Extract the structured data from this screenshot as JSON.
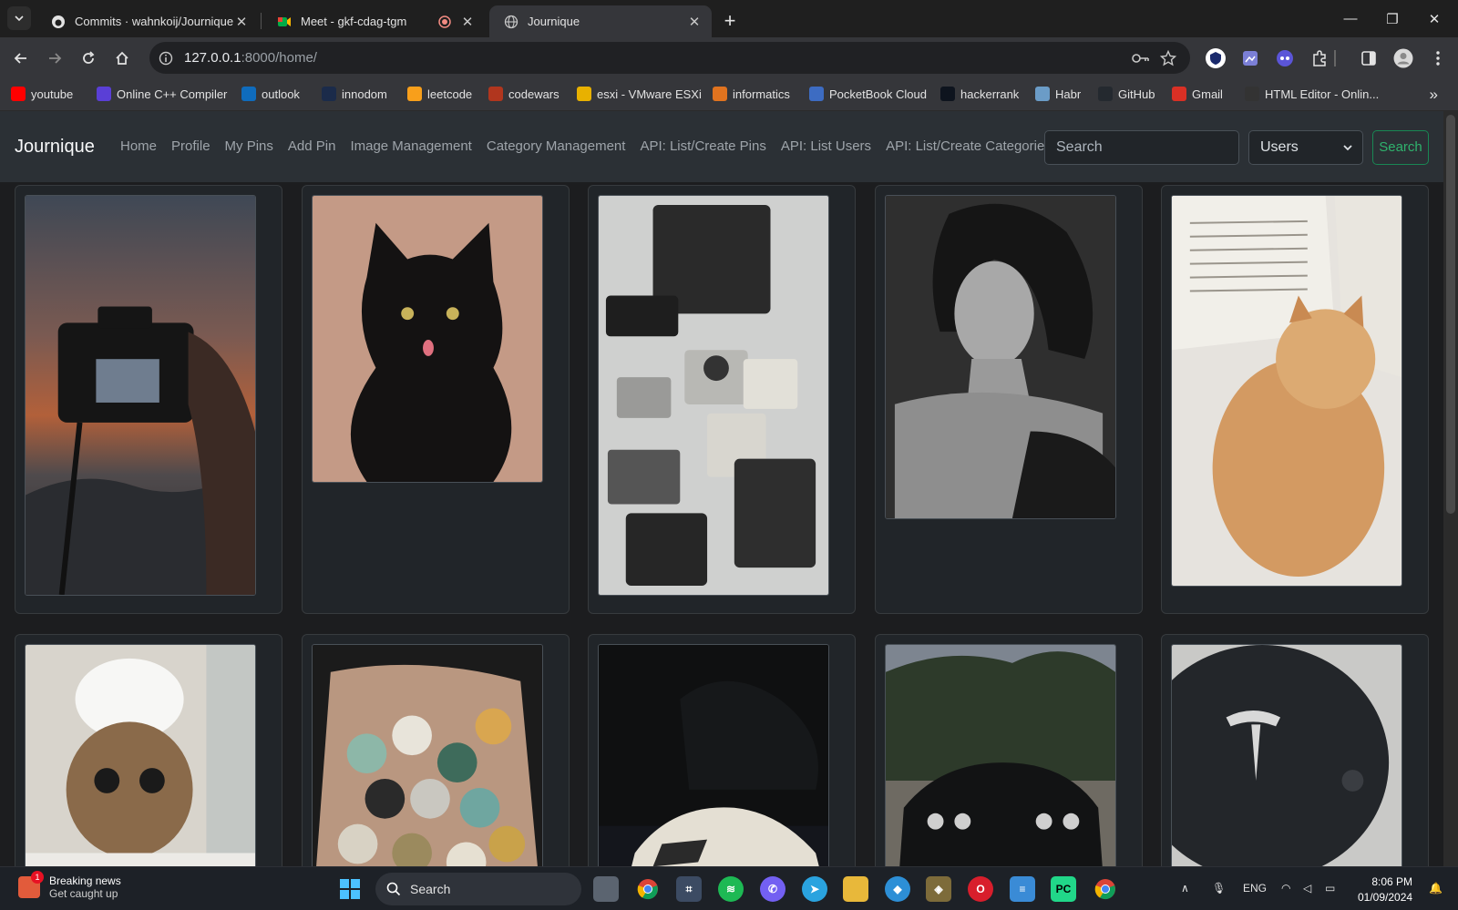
{
  "browser": {
    "tabs": [
      {
        "title": "Commits · wahnkoij/Journique",
        "icon": "github-icon"
      },
      {
        "title": "Meet - gkf-cdag-tgm",
        "icon": "google-meet-icon"
      },
      {
        "title": "Journique",
        "icon": "globe-icon",
        "active": true
      }
    ],
    "url_host": "127.0.0.1",
    "url_rest": ":8000/home/",
    "bookmarks": [
      {
        "label": "youtube",
        "color": "#ff0000"
      },
      {
        "label": "Online C++ Compiler",
        "color": "#5a3fd6"
      },
      {
        "label": "outlook",
        "color": "#0f6cbd"
      },
      {
        "label": "innodom",
        "color": "#1b2b4a"
      },
      {
        "label": "leetcode",
        "color": "#f89f1b"
      },
      {
        "label": "codewars",
        "color": "#b1361e"
      },
      {
        "label": "esxi - VMware ESXi",
        "color": "#e8b100"
      },
      {
        "label": "informatics",
        "color": "#e0731f"
      },
      {
        "label": "PocketBook Cloud",
        "color": "#3d6cc2"
      },
      {
        "label": "hackerrank",
        "color": "#0e141e"
      },
      {
        "label": "Habr",
        "color": "#6b9cc7"
      },
      {
        "label": "GitHub",
        "color": "#24292f"
      },
      {
        "label": "Gmail",
        "color": "#d93025"
      },
      {
        "label": "HTML Editor - Onlin...",
        "color": "#333333"
      }
    ]
  },
  "app": {
    "brand": "Journique",
    "nav": [
      "Home",
      "Profile",
      "My Pins",
      "Add Pin",
      "Image Management",
      "Category Management",
      "API: List/Create Pins",
      "API: List Users",
      "API: List/Create Categories"
    ],
    "search_placeholder": "Search",
    "filter_selected": "Users",
    "search_button": "Search",
    "pins": [
      {
        "subject": "camera-sunset"
      },
      {
        "subject": "black-cat"
      },
      {
        "subject": "vintage-cameras"
      },
      {
        "subject": "bw-portrait"
      },
      {
        "subject": "kitten-book"
      },
      {
        "subject": "bath-kitten"
      },
      {
        "subject": "bottle-caps"
      },
      {
        "subject": "sports-car-night"
      },
      {
        "subject": "muscle-car"
      },
      {
        "subject": "tesla-wheel"
      }
    ]
  },
  "taskbar": {
    "news_title": "Breaking news",
    "news_subtitle": "Get caught up",
    "news_badge": "1",
    "search_label": "Search",
    "lang": "ENG",
    "time": "8:06 PM",
    "date": "01/09/2024"
  }
}
